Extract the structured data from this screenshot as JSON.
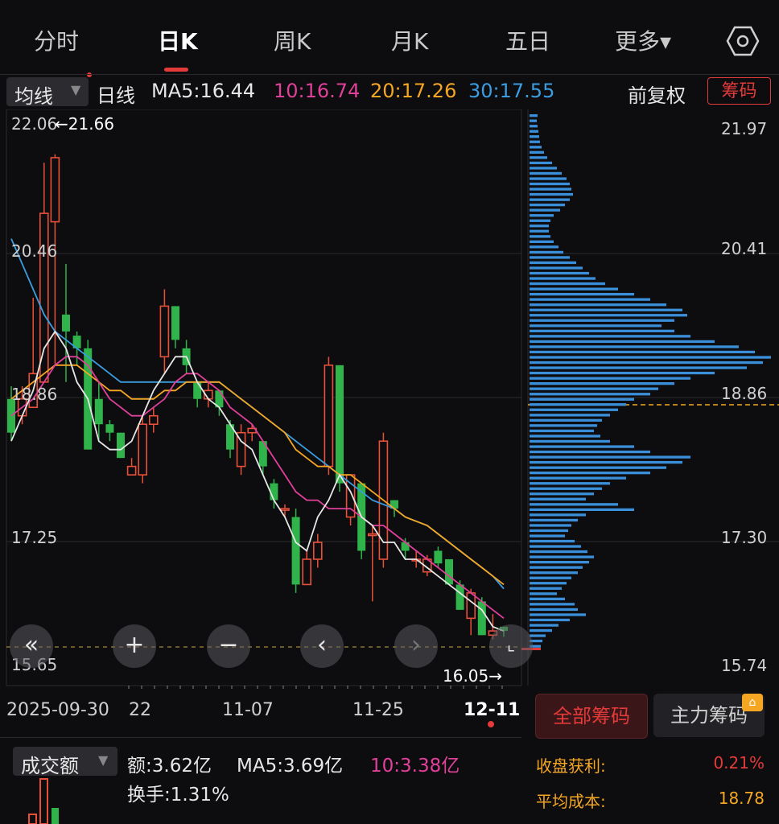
{
  "tabs": [
    {
      "label": "分时"
    },
    {
      "label": "日K"
    },
    {
      "label": "周K"
    },
    {
      "label": "月K"
    },
    {
      "label": "五日"
    },
    {
      "label": "更多▾"
    }
  ],
  "ma_bar": {
    "dropdown": "均线",
    "period": "日线",
    "ma5": "MA5:16.44",
    "ma10": "10:16.74",
    "ma20": "20:17.26",
    "ma30": "30:17.55",
    "adjust": "前复权",
    "chip_button": "筹码"
  },
  "colors": {
    "up": "#e8503a",
    "down": "#2fb34a",
    "ma5": "#e6e6e6",
    "ma10": "#e0409a",
    "ma20": "#f5a623",
    "ma30": "#3b9de0",
    "profile": "#3b8fd9",
    "accent": "#e33a3a"
  },
  "price_axis": {
    "top": "22.06",
    "l2": "20.46",
    "l3": "18.86",
    "l4": "17.25",
    "bottom": "15.65",
    "high_marker": "←21.66",
    "low_marker": "16.05→"
  },
  "chip_axis": {
    "top": "21.97",
    "l2": "20.41",
    "l3": "18.86",
    "l4": "17.30",
    "bottom": "15.74"
  },
  "dates": {
    "d1": "2025-09-30",
    "d1b": "22",
    "d2": "11-07",
    "d3": "11-25",
    "d4": "12-11"
  },
  "icons": {
    "rewind": "double-left-icon",
    "zoom_in": "plus-icon",
    "zoom_out": "minus-icon",
    "prev": "chevron-left-icon",
    "next": "chevron-right-icon",
    "fullscreen": "expand-icon",
    "settings": "settings-hexagon-icon"
  },
  "chip_panel": {
    "all_button": "全部筹码",
    "main_button": "主力筹码",
    "profit_label": "收盘获利:",
    "profit_value": "0.21%",
    "cost_label": "平均成本:",
    "cost_value": "18.78"
  },
  "volume": {
    "dropdown": "成交额",
    "amount": "额:3.62亿",
    "ma5": "MA5:3.69亿",
    "ma10": "10:3.38亿",
    "turnover": "换手:1.31%"
  },
  "chart_data": {
    "type": "candlestick",
    "price_range": [
      15.65,
      22.06
    ],
    "candles": [
      [
        18.8,
        18.4,
        18.95,
        18.3
      ],
      [
        18.6,
        18.8,
        18.95,
        18.5
      ],
      [
        18.7,
        19.1,
        20.0,
        18.7
      ],
      [
        19.0,
        21.0,
        21.6,
        19.0
      ],
      [
        20.9,
        21.66,
        21.7,
        19.2
      ],
      [
        19.8,
        19.6,
        20.4,
        19.0
      ],
      [
        19.55,
        19.4,
        19.6,
        19.2
      ],
      [
        19.4,
        18.2,
        19.5,
        18.2
      ],
      [
        18.8,
        18.5,
        19.0,
        18.3
      ],
      [
        18.5,
        18.4,
        18.55,
        18.3
      ],
      [
        18.4,
        18.1,
        18.4,
        18.1
      ],
      [
        17.9,
        18.0,
        18.1,
        17.9
      ],
      [
        17.9,
        18.5,
        18.6,
        17.8
      ],
      [
        18.5,
        18.6,
        18.7,
        18.4
      ],
      [
        19.3,
        19.9,
        20.1,
        19.1
      ],
      [
        19.9,
        19.5,
        19.9,
        19.4
      ],
      [
        19.4,
        19.2,
        19.5,
        19.1
      ],
      [
        19.0,
        18.8,
        19.0,
        18.7
      ],
      [
        18.8,
        18.9,
        19.0,
        18.7
      ],
      [
        18.9,
        18.7,
        18.9,
        18.6
      ],
      [
        18.5,
        18.2,
        18.55,
        18.1
      ],
      [
        18.0,
        18.4,
        18.5,
        17.9
      ],
      [
        18.4,
        18.45,
        18.5,
        18.3
      ],
      [
        18.3,
        18.0,
        18.3,
        17.9
      ],
      [
        17.8,
        17.6,
        17.85,
        17.5
      ],
      [
        17.5,
        17.5,
        17.55,
        17.4
      ],
      [
        17.4,
        16.6,
        17.5,
        16.5
      ],
      [
        16.6,
        16.9,
        17.0,
        16.6
      ],
      [
        16.9,
        17.1,
        17.2,
        16.8
      ],
      [
        18.0,
        19.2,
        19.3,
        17.9
      ],
      [
        19.2,
        17.8,
        19.2,
        17.7
      ],
      [
        17.4,
        17.9,
        17.9,
        17.3
      ],
      [
        17.8,
        17.0,
        17.8,
        16.9
      ],
      [
        17.2,
        17.2,
        17.3,
        16.4
      ],
      [
        16.9,
        18.3,
        18.4,
        16.8
      ],
      [
        17.6,
        17.5,
        17.6,
        17.4
      ],
      [
        17.1,
        17.0,
        17.15,
        16.9
      ],
      [
        16.9,
        16.9,
        17.0,
        16.8
      ],
      [
        16.75,
        16.9,
        16.95,
        16.7
      ],
      [
        17.0,
        16.85,
        17.05,
        16.8
      ],
      [
        16.9,
        16.6,
        16.9,
        16.6
      ],
      [
        16.6,
        16.3,
        16.65,
        16.3
      ],
      [
        16.2,
        16.5,
        16.55,
        16.0
      ],
      [
        16.4,
        16.0,
        16.45,
        16.0
      ],
      [
        16.0,
        16.05,
        16.25,
        15.95
      ],
      [
        16.1,
        16.05,
        16.1,
        15.98
      ]
    ],
    "ma5": [
      18.3,
      18.6,
      18.9,
      19.4,
      19.6,
      19.4,
      19.0,
      18.8,
      18.3,
      18.2,
      18.2,
      18.3,
      18.6,
      18.9,
      19.1,
      19.3,
      19.3,
      19.0,
      18.8,
      18.7,
      18.5,
      18.3,
      18.2,
      17.9,
      17.6,
      17.4,
      17.1,
      17.0,
      17.4,
      17.6,
      17.9,
      17.7,
      17.4,
      17.3,
      17.1,
      17.1,
      16.9,
      16.9,
      16.8,
      16.7,
      16.6,
      16.5,
      16.4,
      16.3,
      16.1,
      16.05
    ],
    "ma10": [
      18.6,
      18.7,
      18.8,
      19.0,
      19.2,
      19.3,
      19.3,
      19.2,
      19.0,
      18.8,
      18.7,
      18.6,
      18.6,
      18.7,
      18.8,
      19.0,
      19.1,
      19.1,
      19.0,
      18.9,
      18.7,
      18.6,
      18.5,
      18.3,
      18.1,
      17.9,
      17.7,
      17.6,
      17.6,
      17.5,
      17.5,
      17.5,
      17.4,
      17.3,
      17.3,
      17.2,
      17.1,
      17.0,
      16.9,
      16.8,
      16.7,
      16.6,
      16.5,
      16.4,
      16.3,
      16.2
    ],
    "ma20": [
      18.8,
      18.9,
      19.0,
      19.1,
      19.2,
      19.2,
      19.2,
      19.1,
      19.0,
      18.9,
      18.9,
      18.8,
      18.8,
      18.8,
      18.9,
      18.9,
      19.0,
      19.0,
      19.0,
      19.0,
      18.9,
      18.8,
      18.7,
      18.6,
      18.5,
      18.4,
      18.2,
      18.1,
      18.0,
      18.0,
      17.9,
      17.9,
      17.8,
      17.7,
      17.6,
      17.5,
      17.4,
      17.35,
      17.3,
      17.2,
      17.1,
      17.0,
      16.9,
      16.8,
      16.7,
      16.6
    ],
    "ma30": [
      20.7,
      20.4,
      20.1,
      19.8,
      19.6,
      19.5,
      19.4,
      19.3,
      19.2,
      19.1,
      19.0,
      19.0,
      19.0,
      19.0,
      19.0,
      19.0,
      19.0,
      19.0,
      19.0,
      19.0,
      18.9,
      18.8,
      18.7,
      18.6,
      18.5,
      18.4,
      18.3,
      18.2,
      18.1,
      18.0,
      17.9,
      17.8,
      17.7,
      17.6,
      17.55,
      17.5,
      17.4,
      17.35,
      17.3,
      17.2,
      17.1,
      17.0,
      16.9,
      16.8,
      16.7,
      16.55
    ],
    "chip_profile": [
      10,
      9,
      10,
      11,
      12,
      13,
      15,
      18,
      22,
      28,
      34,
      40,
      46,
      50,
      52,
      54,
      50,
      44,
      38,
      30,
      26,
      24,
      24,
      26,
      30,
      36,
      42,
      50,
      58,
      66,
      74,
      82,
      94,
      110,
      130,
      150,
      170,
      190,
      196,
      180,
      164,
      180,
      200,
      230,
      260,
      280,
      300,
      290,
      270,
      230,
      200,
      180,
      160,
      150,
      130,
      120,
      110,
      100,
      90,
      84,
      80,
      88,
      100,
      130,
      150,
      200,
      190,
      170,
      150,
      120,
      100,
      90,
      80,
      70,
      110,
      130,
      70,
      60,
      52,
      48,
      44,
      56,
      64,
      72,
      80,
      74,
      66,
      60,
      52,
      46,
      40,
      34,
      44,
      56,
      60,
      70,
      50,
      36,
      28,
      20,
      16,
      14
    ]
  }
}
